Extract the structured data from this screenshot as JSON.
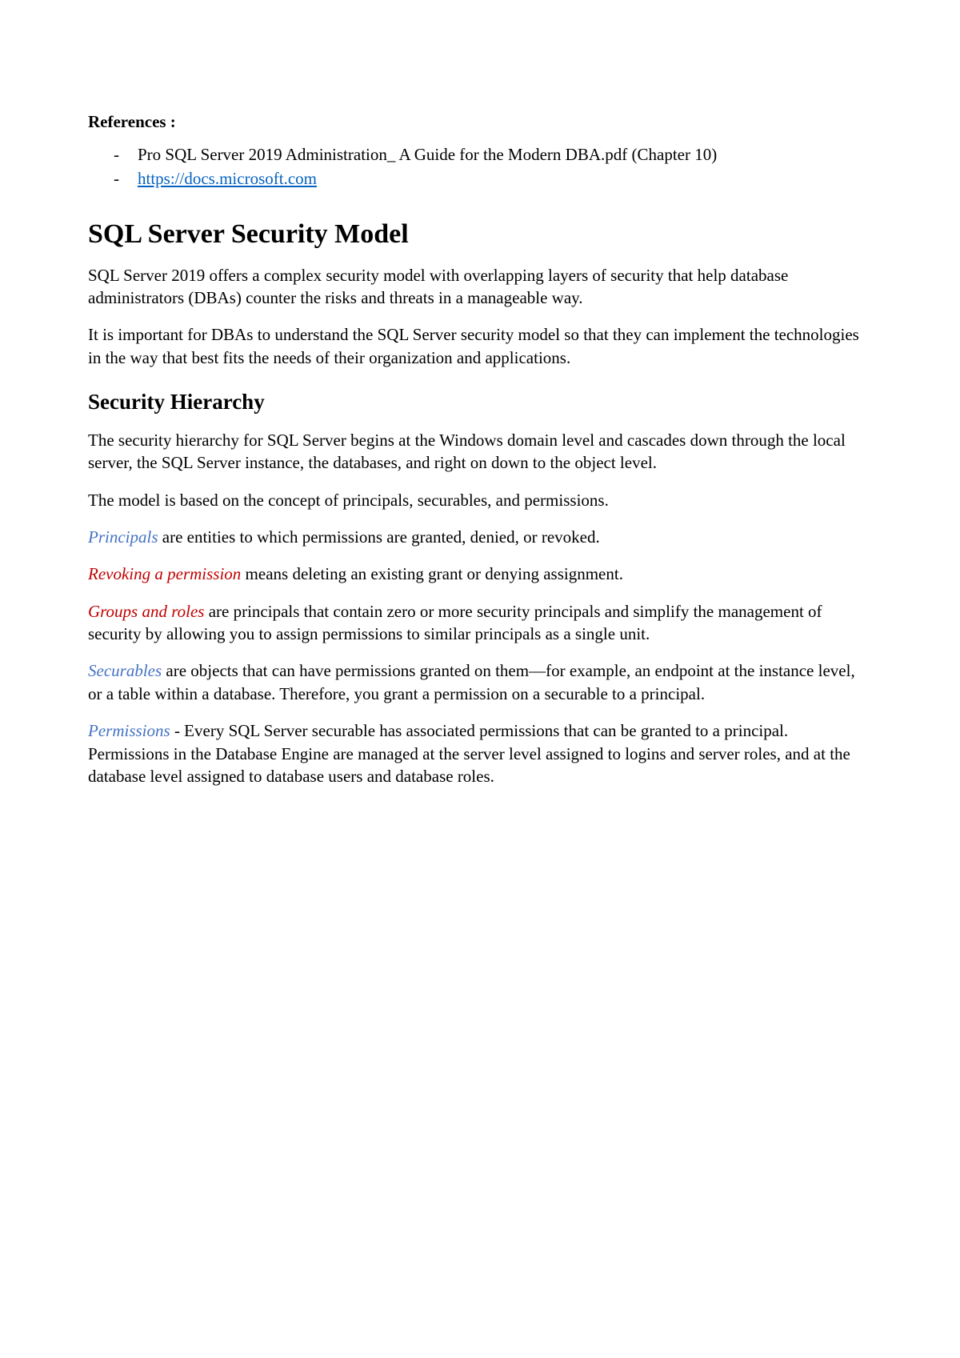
{
  "references": {
    "heading": "References :",
    "items": [
      "Pro SQL Server 2019 Administration_ A Guide for the Modern DBA.pdf (Chapter 10)",
      "https://docs.microsoft.com"
    ]
  },
  "title": "SQL Server Security Model",
  "intro_p1": "SQL Server 2019 offers a complex security model with overlapping layers of security that help database administrators (DBAs) counter the risks and threats in a manageable way.",
  "intro_p2": "It is important for DBAs to understand the SQL Server security model so that they can implement the technologies in the way that best fits the needs of their organization and applications.",
  "subtitle": "Security Hierarchy",
  "hierarchy_p1": "The security hierarchy for SQL Server begins at the Windows domain level and cascades down through the local server, the SQL Server instance, the databases, and right on down to the object level.",
  "hierarchy_p2": "The model is based on the concept of principals, securables, and permissions.",
  "definitions": {
    "principals": {
      "term": "Principals",
      "text": " are entities to which permissions are granted, denied, or revoked."
    },
    "revoking": {
      "term": "Revoking a permission",
      "text": " means deleting an existing grant or denying assignment."
    },
    "groups_roles": {
      "term": "Groups and roles",
      "text": " are principals that contain zero or more security principals and simplify the management of security by allowing you to assign permissions to similar principals as a single unit."
    },
    "securables": {
      "term": "Securables",
      "text": " are objects that can have permissions granted on them—for example, an endpoint at the instance level, or a table within a database. Therefore, you grant a permission on a securable to a principal."
    },
    "permissions": {
      "term": "Permissions",
      "text": " - Every SQL Server securable has associated permissions that can be granted to a principal. Permissions in the Database Engine are managed at the server level assigned to logins and server roles, and at the database level assigned to database users and database roles."
    }
  }
}
